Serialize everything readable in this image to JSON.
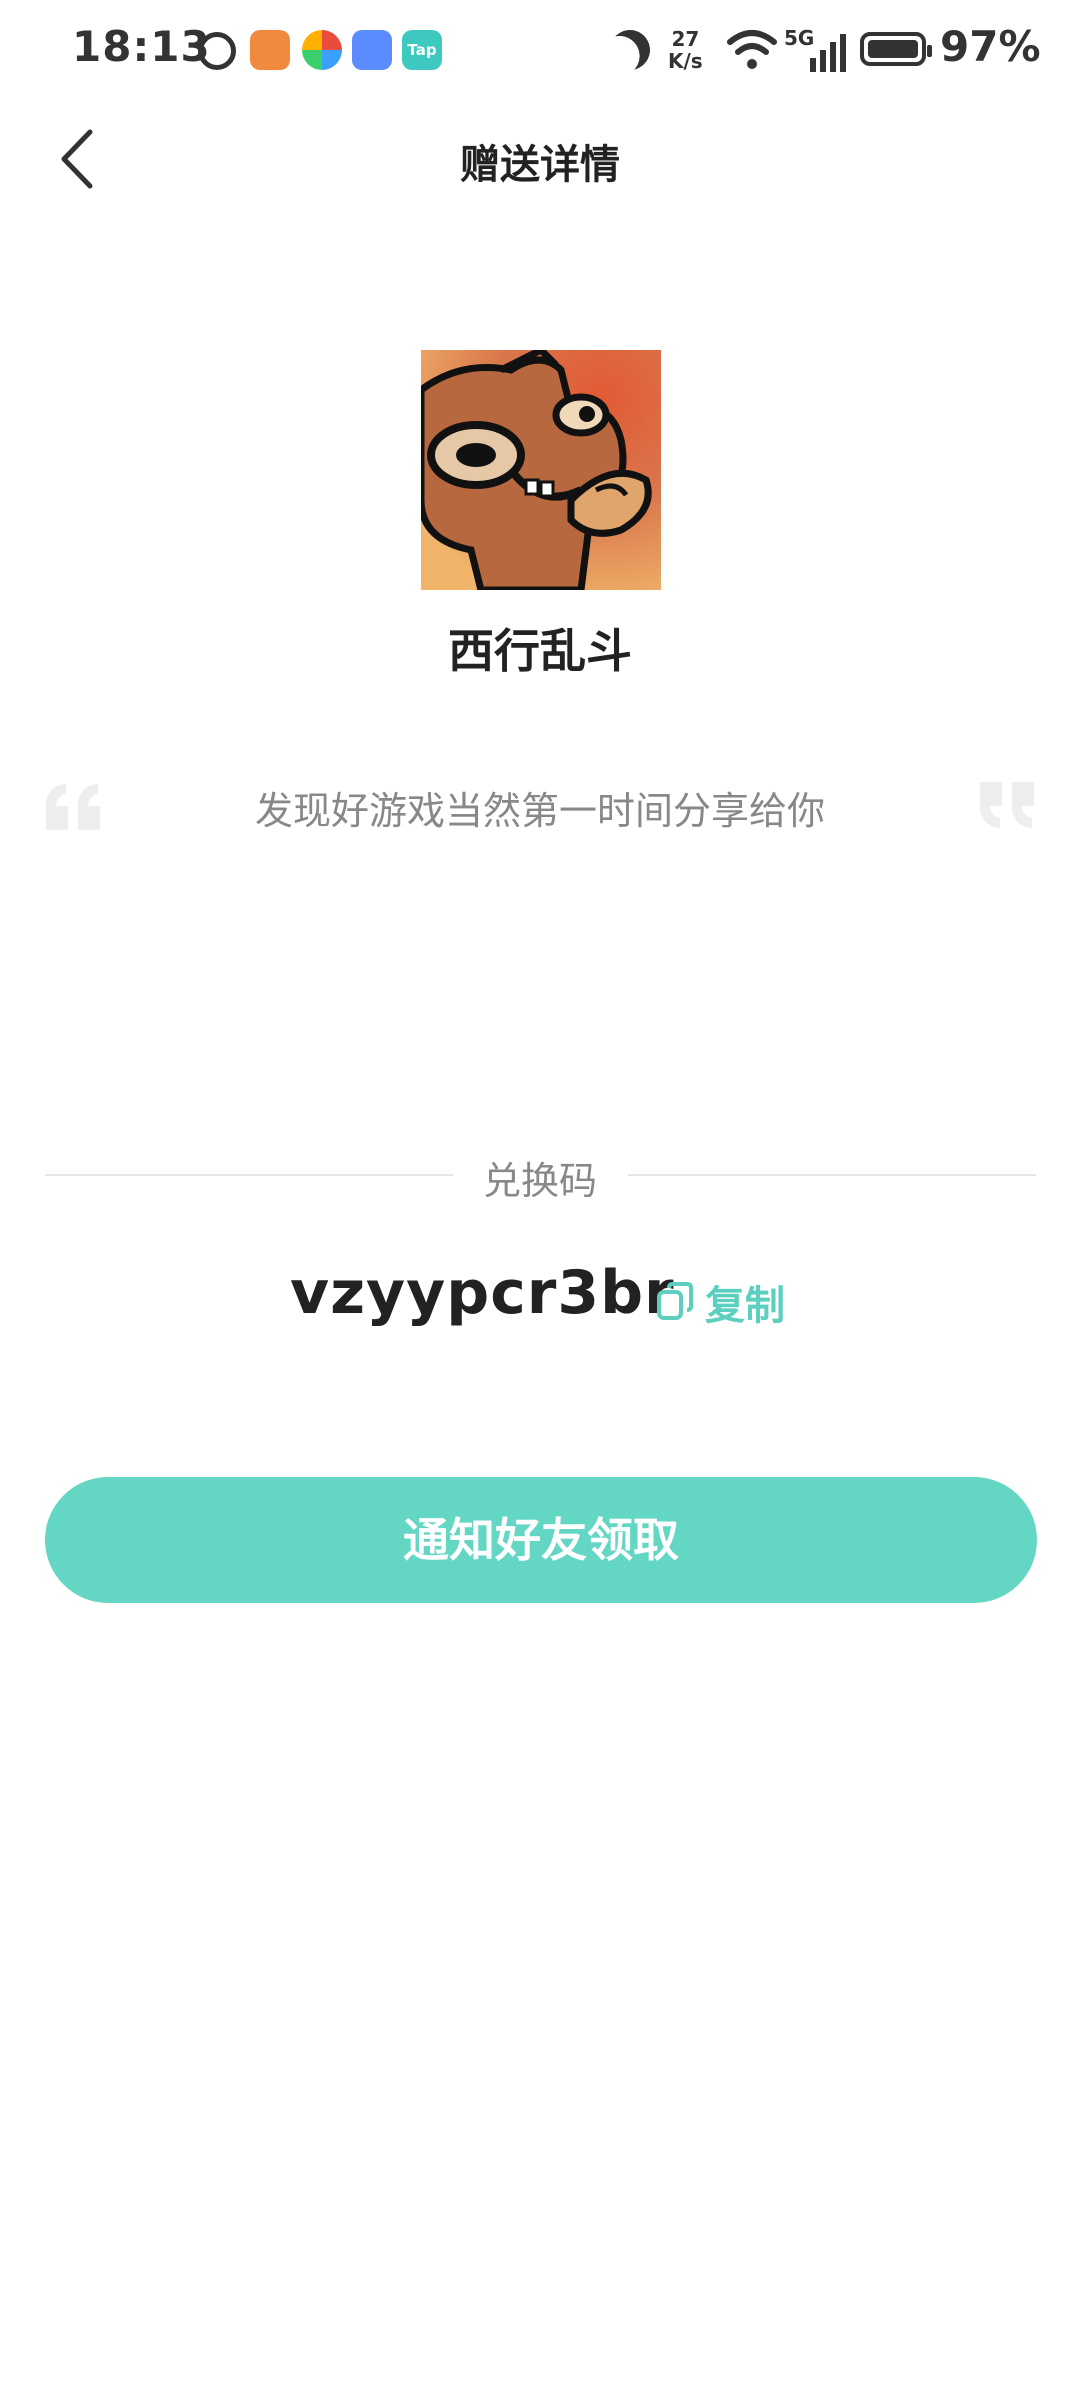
{
  "status_bar": {
    "time": "18:13",
    "net_speed_value": "27",
    "net_speed_unit": "K/s",
    "network_type": "5G",
    "battery_percent": "97%",
    "battery_level": 0.97,
    "app_icons": [
      "alarm-icon",
      "orange-heart-app-icon",
      "colorful-app-icon",
      "blue-app-icon",
      "taptap-app-icon"
    ],
    "taptap_label": "Tap"
  },
  "header": {
    "title": "赠送详情"
  },
  "game": {
    "name": "西行乱斗"
  },
  "quote": {
    "text": "发现好游戏当然第一时间分享给你"
  },
  "redeem": {
    "label": "兑换码",
    "code": "vzyypcr3br",
    "copy_label": "复制"
  },
  "actions": {
    "notify_label": "通知好友领取"
  },
  "colors": {
    "accent": "#63d6c4",
    "accent_text": "#5ccfbe",
    "secondary_text": "#888888"
  }
}
